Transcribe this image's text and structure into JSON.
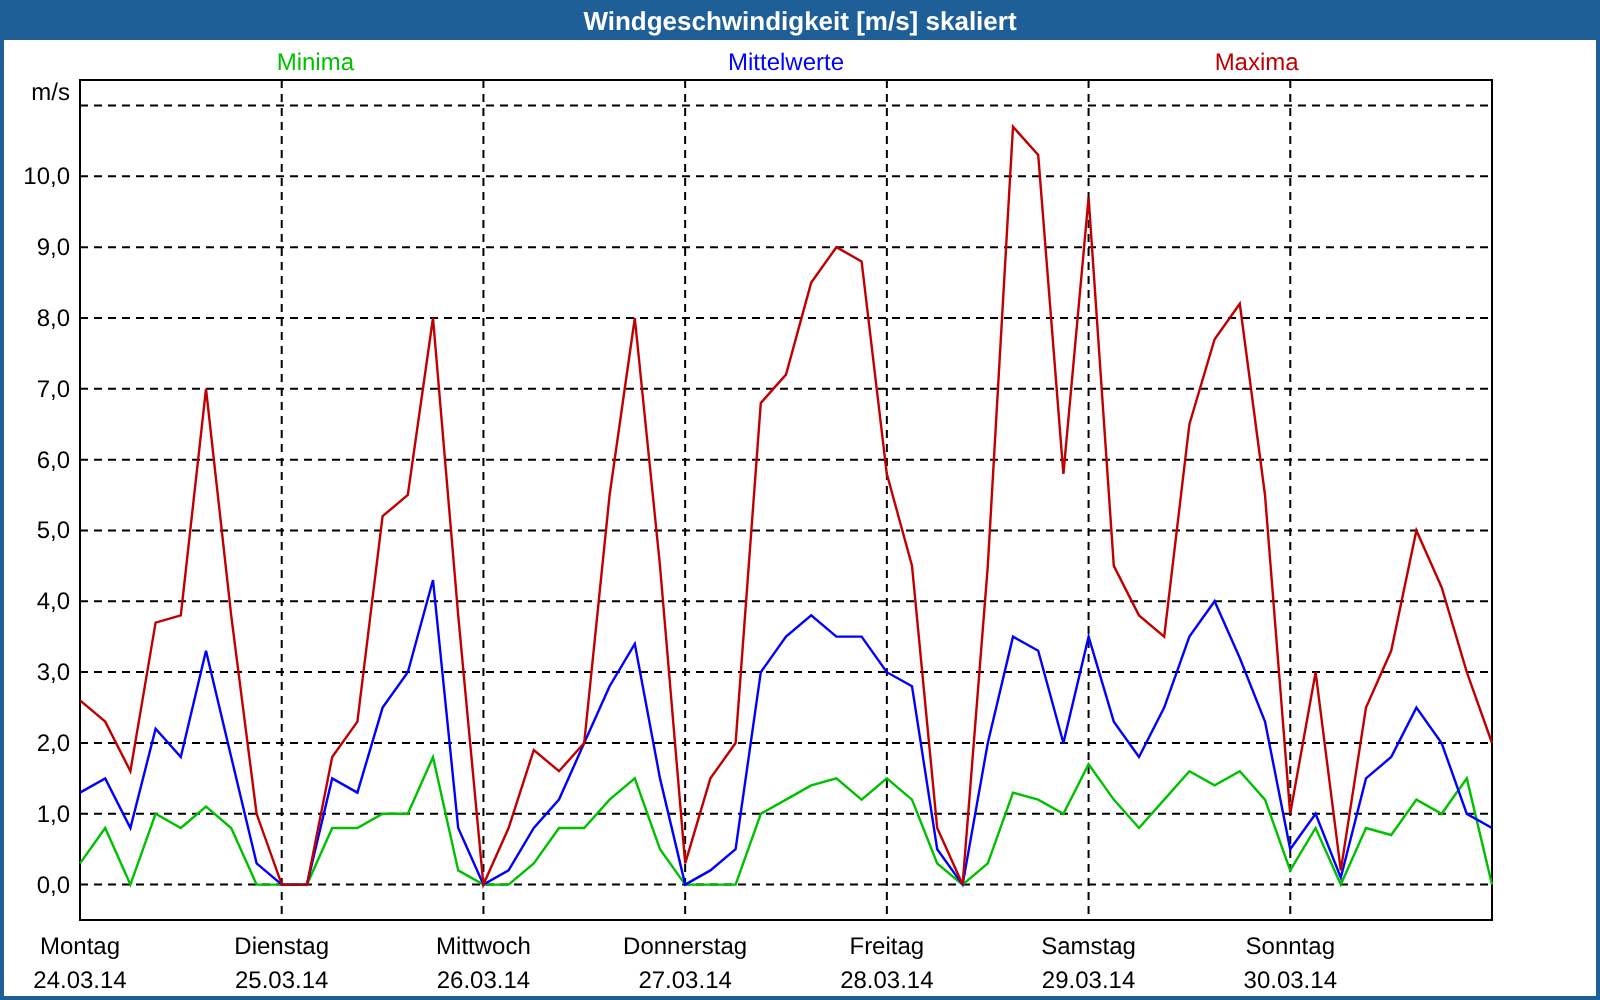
{
  "window": {
    "title": "Windgeschwindigkeit [m/s] skaliert"
  },
  "chart": {
    "chart_data": {
      "type": "line",
      "ylabel": "m/s",
      "categories": [
        "Montag",
        null,
        null,
        null,
        null,
        null,
        null,
        null,
        "Dienstag",
        null,
        null,
        null,
        null,
        null,
        null,
        null,
        "Mittwoch",
        null,
        null,
        null,
        null,
        null,
        null,
        null,
        "Donnerstag",
        null,
        null,
        null,
        null,
        null,
        null,
        null,
        "Freitag",
        null,
        null,
        null,
        null,
        null,
        null,
        null,
        "Samstag",
        null,
        null,
        null,
        null,
        null,
        null,
        null,
        "Sonntag",
        null,
        null,
        null,
        null,
        null,
        null,
        null,
        null
      ],
      "ylim": [
        -0.5,
        11.36
      ],
      "grid": true,
      "yticks": [
        {
          "value": 0,
          "label": "0,0"
        },
        {
          "value": 1,
          "label": "1,0"
        },
        {
          "value": 2,
          "label": "2,0"
        },
        {
          "value": 3,
          "label": "3,0"
        },
        {
          "value": 4,
          "label": "4,0"
        },
        {
          "value": 5,
          "label": "5,0"
        },
        {
          "value": 6,
          "label": "6,0"
        },
        {
          "value": 7,
          "label": "7,0"
        },
        {
          "value": 8,
          "label": "8,0"
        },
        {
          "value": 9,
          "label": "9,0"
        },
        {
          "value": 10,
          "label": "10,0"
        }
      ],
      "series": [
        {
          "name": "Minima",
          "color": "#00c000",
          "values": [
            0.3,
            0.8,
            0,
            1.0,
            0.8,
            1.1,
            0.8,
            0,
            0,
            0,
            0.8,
            0.8,
            1.0,
            1.0,
            1.8,
            0.2,
            0,
            0,
            0.3,
            0.8,
            0.8,
            1.2,
            1.5,
            0.5,
            0,
            0,
            0,
            1.0,
            1.2,
            1.4,
            1.5,
            1.2,
            1.5,
            1.2,
            0.3,
            0,
            0.3,
            1.3,
            1.2,
            1.0,
            1.7,
            1.2,
            0.8,
            1.2,
            1.6,
            1.4,
            1.6,
            1.2,
            0.2,
            0.8,
            0,
            0.8,
            0.7,
            1.2,
            1.0,
            1.5,
            0
          ]
        },
        {
          "name": "Mittelwerte",
          "color": "#0000ff",
          "values": [
            1.3,
            1.5,
            0.8,
            2.2,
            1.8,
            3.3,
            1.8,
            0.3,
            0,
            0,
            1.5,
            1.3,
            2.5,
            3.0,
            4.3,
            0.8,
            0,
            0.2,
            0.8,
            1.2,
            2.0,
            2.8,
            3.4,
            1.5,
            0,
            0.2,
            0.5,
            3.0,
            3.5,
            3.8,
            3.5,
            3.5,
            3.0,
            2.8,
            0.5,
            0,
            2.0,
            3.5,
            3.3,
            2.0,
            3.5,
            2.3,
            1.8,
            2.5,
            3.5,
            4.0,
            3.2,
            2.3,
            0.5,
            1.0,
            0.1,
            1.5,
            1.8,
            2.5,
            2.0,
            1.0,
            0.8
          ]
        },
        {
          "name": "Maxima",
          "color": "#c00000",
          "values": [
            2.6,
            2.3,
            1.6,
            3.7,
            3.8,
            7.0,
            3.8,
            1.0,
            0,
            0,
            1.8,
            2.3,
            5.2,
            5.5,
            8.0,
            3.8,
            0,
            0.8,
            1.9,
            1.6,
            2.0,
            5.5,
            8.0,
            4.5,
            0.3,
            1.5,
            2.0,
            6.8,
            7.2,
            8.5,
            9.0,
            8.8,
            5.8,
            4.5,
            0.8,
            0,
            4.5,
            10.7,
            10.3,
            5.8,
            9.7,
            4.5,
            3.8,
            3.5,
            6.5,
            7.7,
            8.2,
            5.5,
            1.0,
            3.0,
            0.2,
            2.5,
            3.3,
            5.0,
            4.2,
            3.0,
            2.0
          ]
        }
      ]
    },
    "x_axis_dates": [
      "24.03.14",
      "25.03.14",
      "26.03.14",
      "27.03.14",
      "28.03.14",
      "29.03.14",
      "30.03.14"
    ]
  }
}
